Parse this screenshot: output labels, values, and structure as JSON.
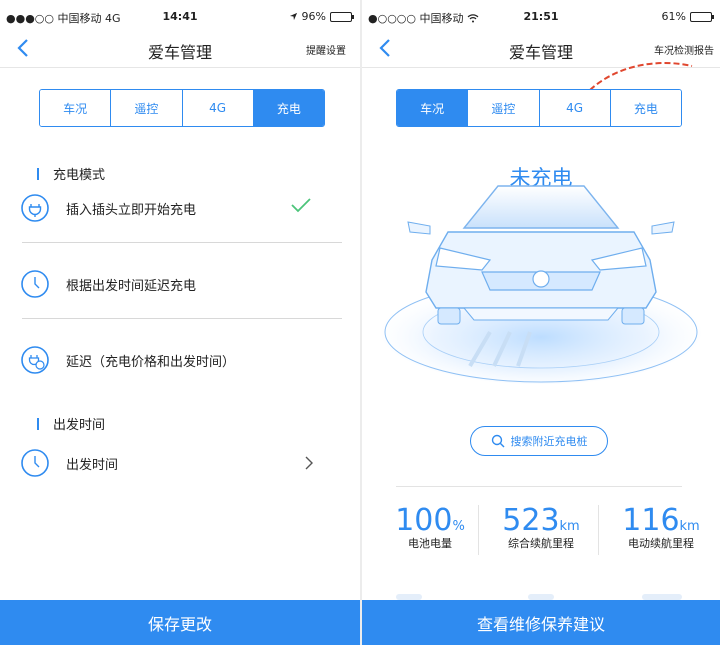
{
  "left": {
    "status": {
      "carrier": "●●●○○ 中国移动 4G",
      "time": "14:41",
      "battery": "96%",
      "battery_level": 0.96
    },
    "nav": {
      "title": "爱车管理",
      "right_link": "提醒设置"
    },
    "tabs": [
      "车况",
      "遥控",
      "4G",
      "充电"
    ],
    "active_tab": 3,
    "charge_mode_label": "充电模式",
    "modes": [
      {
        "label": "插入插头立即开始充电",
        "icon": "plug-icon",
        "selected": true
      },
      {
        "label": "根据出发时间延迟充电",
        "icon": "clock-icon",
        "selected": false
      },
      {
        "label": "延迟（充电价格和出发时间）",
        "icon": "plug-clock-icon",
        "selected": false
      }
    ],
    "depart_label": "出发时间",
    "depart_row": "出发时间",
    "save_button": "保存更改"
  },
  "right": {
    "status": {
      "carrier": "●○○○○ 中国移动",
      "time": "21:51",
      "battery": "61%",
      "battery_level": 0.61
    },
    "nav": {
      "title": "爱车管理",
      "right_link": "车况检测报告"
    },
    "tabs": [
      "车况",
      "遥控",
      "4G",
      "充电"
    ],
    "active_tab": 0,
    "charge_status": "未充电",
    "search_button": "搜索附近充电桩",
    "stats": [
      {
        "value": "100",
        "unit": "%",
        "label": "电池电量"
      },
      {
        "value": "523",
        "unit": "km",
        "label": "综合续航里程"
      },
      {
        "value": "116",
        "unit": "km",
        "label": "电动续航里程"
      }
    ],
    "bottom_button": "查看维修保养建议"
  },
  "colors": {
    "accent": "#2f8bf0",
    "check": "#4cc47a",
    "annotation": "#e0472f"
  }
}
